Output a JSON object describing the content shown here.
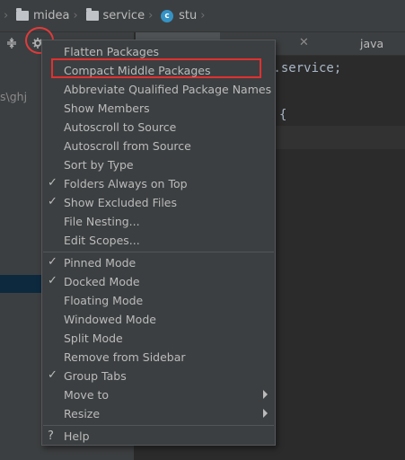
{
  "breadcrumb": {
    "items": [
      {
        "label": "midea",
        "icon": "folder-icon"
      },
      {
        "label": "service",
        "icon": "folder-icon"
      },
      {
        "label": "stu",
        "icon": "class-icon"
      }
    ],
    "class_icon_letter": "c"
  },
  "left_pane": {
    "path_fragment": "s\\ghj"
  },
  "tabs": {
    "visible_tail": "java"
  },
  "editor": {
    "line1": "a.service;",
    "line2": "{"
  },
  "menu": {
    "items": [
      {
        "label": "Flatten Packages",
        "checked": false
      },
      {
        "label": "Compact Middle Packages",
        "checked": false,
        "highlighted_box": true
      },
      {
        "label": "Abbreviate Qualified Package Names",
        "checked": false
      },
      {
        "label": "Show Members",
        "checked": false
      },
      {
        "label": "Autoscroll to Source",
        "checked": false
      },
      {
        "label": "Autoscroll from Source",
        "checked": false
      },
      {
        "label": "Sort by Type",
        "checked": false
      },
      {
        "label": "Folders Always on Top",
        "checked": true
      },
      {
        "label": "Show Excluded Files",
        "checked": true
      },
      {
        "label": "File Nesting...",
        "checked": false
      },
      {
        "label": "Edit Scopes...",
        "checked": false
      },
      {
        "label": "Pinned Mode",
        "checked": true
      },
      {
        "label": "Docked Mode",
        "checked": true
      },
      {
        "label": "Floating Mode",
        "checked": false
      },
      {
        "label": "Windowed Mode",
        "checked": false
      },
      {
        "label": "Split Mode",
        "checked": false
      },
      {
        "label": "Remove from Sidebar",
        "checked": false
      },
      {
        "label": "Group Tabs",
        "checked": true
      },
      {
        "label": "Move to",
        "checked": false,
        "submenu": true
      },
      {
        "label": "Resize",
        "checked": false,
        "submenu": true
      },
      {
        "label": "Help",
        "checked": false
      }
    ],
    "check_glyph": "✓",
    "help_glyph": "?",
    "highlight_color": "#e03131"
  }
}
